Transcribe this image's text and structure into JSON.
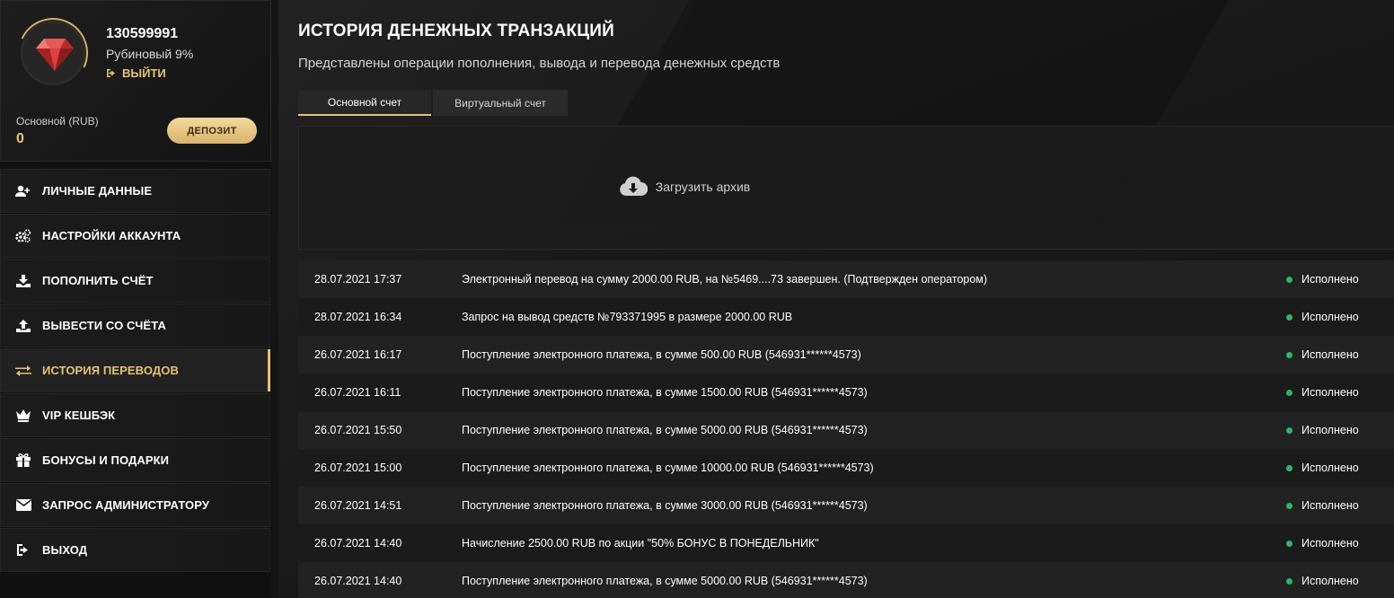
{
  "profile": {
    "user_id": "130599991",
    "level": "Рубиновый 9%",
    "logout_label": "ВЫЙТИ",
    "balance_label": "Основной (RUB)",
    "balance_value": "0",
    "deposit_label": "ДЕПОЗИТ"
  },
  "menu": [
    {
      "label": "ЛИЧНЫЕ ДАННЫЕ",
      "icon": "user-plus-icon"
    },
    {
      "label": "НАСТРОЙКИ АККАУНТА",
      "icon": "gears-icon"
    },
    {
      "label": "ПОПОЛНИТЬ СЧЁТ",
      "icon": "download-icon"
    },
    {
      "label": "ВЫВЕСТИ СО СЧЁТА",
      "icon": "upload-icon"
    },
    {
      "label": "ИСТОРИЯ ПЕРЕВОДОВ",
      "icon": "exchange-icon",
      "active": true
    },
    {
      "label": "VIP КЕШБЭК",
      "icon": "crown-icon"
    },
    {
      "label": "БОНУСЫ И ПОДАРКИ",
      "icon": "gift-icon"
    },
    {
      "label": "ЗАПРОС АДМИНИСТРАТОРУ",
      "icon": "envelope-icon"
    },
    {
      "label": "ВЫХОД",
      "icon": "sign-out-icon"
    }
  ],
  "main": {
    "title": "ИСТОРИЯ ДЕНЕЖНЫХ ТРАНЗАКЦИЙ",
    "subtitle": "Представлены операции пополнения, вывода и перевода денежных средств",
    "tabs": [
      {
        "label": "Основной счет",
        "active": true
      },
      {
        "label": "Виртуальный счет",
        "active": false
      }
    ],
    "archive_label": "Загрузить архив"
  },
  "transactions": [
    {
      "date": "28.07.2021 17:37",
      "desc": "Электронный перевод на сумму 2000.00 RUB, на №5469....73 завершен. (Подтвержден оператором)",
      "status": "Исполнено"
    },
    {
      "date": "28.07.2021 16:34",
      "desc": "Запрос на вывод средств №793371995 в размере 2000.00 RUB",
      "status": "Исполнено"
    },
    {
      "date": "26.07.2021 16:17",
      "desc": "Поступление электронного платежа, в сумме 500.00 RUB (546931******4573)",
      "status": "Исполнено"
    },
    {
      "date": "26.07.2021 16:11",
      "desc": "Поступление электронного платежа, в сумме 1500.00 RUB (546931******4573)",
      "status": "Исполнено"
    },
    {
      "date": "26.07.2021 15:50",
      "desc": "Поступление электронного платежа, в сумме 5000.00 RUB (546931******4573)",
      "status": "Исполнено"
    },
    {
      "date": "26.07.2021 15:00",
      "desc": "Поступление электронного платежа, в сумме 10000.00 RUB (546931******4573)",
      "status": "Исполнено"
    },
    {
      "date": "26.07.2021 14:51",
      "desc": "Поступление электронного платежа, в сумме 3000.00 RUB (546931******4573)",
      "status": "Исполнено"
    },
    {
      "date": "26.07.2021 14:40",
      "desc": "Начисление 2500.00 RUB по акции \"50% БОНУС В ПОНЕДЕЛЬНИК\"",
      "status": "Исполнено"
    },
    {
      "date": "26.07.2021 14:40",
      "desc": "Поступление электронного платежа, в сумме 5000.00 RUB (546931******4573)",
      "status": "Исполнено"
    }
  ],
  "colors": {
    "accent": "#e8c36f",
    "status_ok": "#2fb46a",
    "background": "#151515"
  }
}
